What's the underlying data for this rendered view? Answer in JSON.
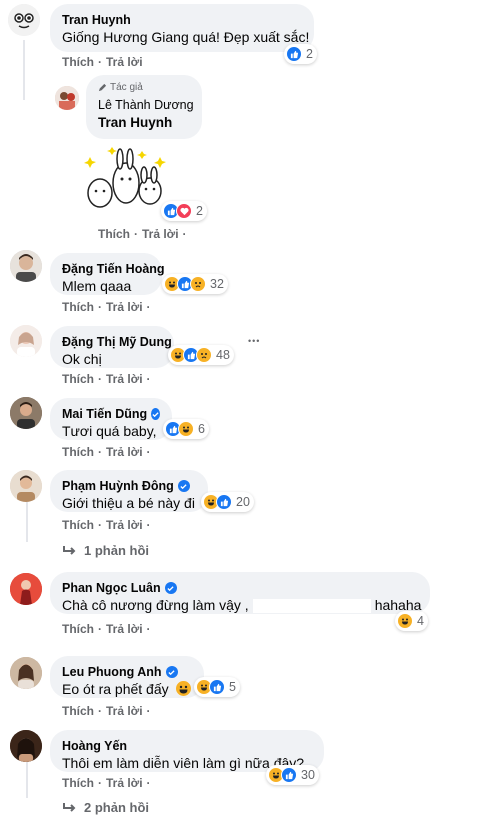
{
  "actions": {
    "like": "Thích",
    "reply": "Trả lời",
    "sep": "·"
  },
  "comments": [
    {
      "name": "Tran Huynh",
      "text": "Giống Hương Giang quá! Đẹp xuất sắc!",
      "reaction_count": "2",
      "reactions": [
        "like"
      ]
    },
    {
      "author_tag": "Tác giả",
      "name": "Lê Thành Dương",
      "text": "Tran Huynh",
      "reaction_count": "2",
      "reactions": [
        "like",
        "love"
      ],
      "sticker": "bunny-sticker"
    },
    {
      "name": "Đặng Tiến Hoàng",
      "text": "Mlem qaaa",
      "reaction_count": "32",
      "reactions": [
        "haha",
        "like",
        "sad"
      ]
    },
    {
      "name": "Đặng Thị Mỹ Dung",
      "text": "Ok chị",
      "reaction_count": "48",
      "reactions": [
        "haha",
        "like",
        "sad"
      ],
      "more": "•••"
    },
    {
      "name": "Mai Tiến Dũng",
      "verified": true,
      "text": "Tươi quá baby,",
      "reaction_count": "6",
      "reactions": [
        "like",
        "haha"
      ]
    },
    {
      "name": "Phạm Huỳnh Đông",
      "verified": true,
      "text": "Giới thiệu a bé này đi",
      "reaction_count": "20",
      "reactions": [
        "haha",
        "like"
      ],
      "replies": "1 phản hồi"
    },
    {
      "name": "Phan Ngọc Luân",
      "verified": true,
      "text_start": "Chà cô nương đừng làm vậy ,",
      "text_end": "hahaha",
      "reaction_count": "4",
      "reactions": [
        "haha"
      ]
    },
    {
      "name": "Leu Phuong Anh",
      "verified": true,
      "text": "Eo ót ra phết đấy",
      "reaction_count": "5",
      "reactions": [
        "haha",
        "like"
      ]
    },
    {
      "name": "Hoàng Yến",
      "text": "Thôi em làm diễn viên làm gì nữa đây? ..",
      "reaction_count": "30",
      "reactions": [
        "haha",
        "like"
      ],
      "replies": "2 phản hồi"
    }
  ],
  "colors": {
    "like": "#1877f2",
    "love": "#f33e58",
    "haha": "#f7b125",
    "bubble": "#f0f2f5",
    "meta": "#65676b"
  }
}
